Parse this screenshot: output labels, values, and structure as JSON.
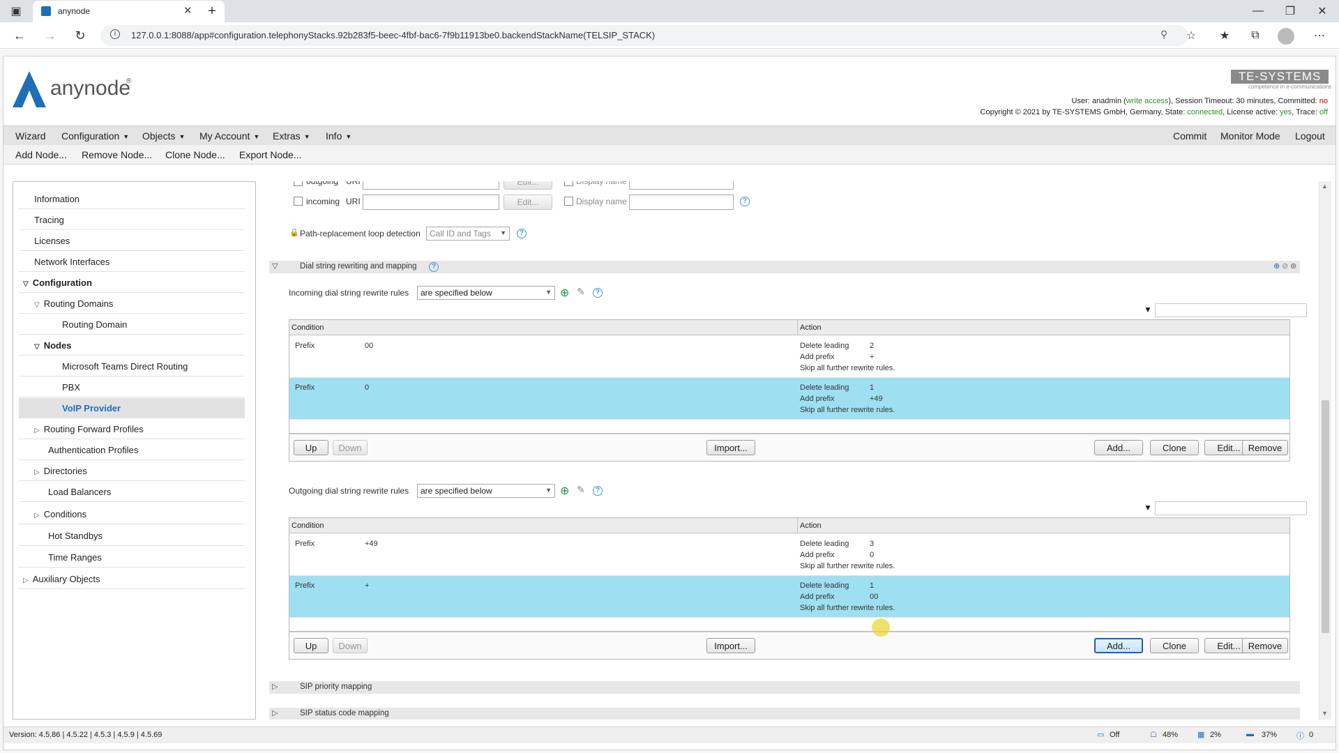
{
  "browser": {
    "tab_title": "anynode",
    "url": "127.0.0.1:8088/app#configuration.telephonyStacks.92b283f5-beec-4fbf-bac6-7f9b11913be0.backendStackName(TELSIP_STACK)"
  },
  "header": {
    "logo_text": "anynode",
    "brand": "TE-SYSTEMS",
    "brand_tagline": "competence in e-communications",
    "user_line_prefix": "User: anadmin (",
    "user_access": "write access",
    "user_line_suffix": "), Session Timeout: 30 minutes, Committed: ",
    "committed": "no",
    "copyright_prefix": "Copyright © 2021 by TE-SYSTEMS GmbH, Germany, State: ",
    "state": "connected",
    "license_prefix": ", License active: ",
    "license_active": "yes",
    "trace_prefix": ", Trace: ",
    "trace": "off"
  },
  "menu": {
    "wizard": "Wizard",
    "configuration": "Configuration",
    "objects": "Objects",
    "my_account": "My Account",
    "extras": "Extras",
    "info": "Info",
    "commit": "Commit",
    "monitor_mode": "Monitor Mode",
    "logout": "Logout"
  },
  "toolbar": {
    "add_node": "Add Node...",
    "remove_node": "Remove Node...",
    "clone_node": "Clone Node...",
    "export_node": "Export Node..."
  },
  "tree": {
    "information": "Information",
    "tracing": "Tracing",
    "licenses": "Licenses",
    "network_interfaces": "Network Interfaces",
    "configuration": "Configuration",
    "routing_domains": "Routing Domains",
    "routing_domain": "Routing Domain",
    "nodes": "Nodes",
    "ms_teams": "Microsoft Teams Direct Routing",
    "pbx": "PBX",
    "voip_provider": "VoIP Provider",
    "routing_forward_profiles": "Routing Forward Profiles",
    "authentication_profiles": "Authentication Profiles",
    "directories": "Directories",
    "load_balancers": "Load Balancers",
    "conditions": "Conditions",
    "hot_standbys": "Hot Standbys",
    "time_ranges": "Time Ranges",
    "auxiliary_objects": "Auxiliary Objects"
  },
  "content": {
    "outgoing_label": "outgoing",
    "incoming_label": "incoming",
    "uri_label": "URI",
    "edit_label": "Edit...",
    "display_name_label": "Display name",
    "path_replacement_label": "Path-replacement loop detection",
    "path_replacement_value": "Call ID and Tags",
    "dial_section_title": "Dial string rewriting and mapping",
    "incoming_rules_label": "Incoming dial string rewrite rules",
    "incoming_rules_value": "are specified below",
    "outgoing_rules_label": "Outgoing dial string rewrite rules",
    "outgoing_rules_value": "are specified below",
    "col_condition": "Condition",
    "col_action": "Action",
    "incoming_rows": [
      {
        "cond": "Prefix",
        "val": "00",
        "a1": "Delete leading",
        "v1": "2",
        "a2": "Add prefix",
        "v2": "+",
        "a3": "Skip all further rewrite rules."
      },
      {
        "cond": "Prefix",
        "val": "0",
        "a1": "Delete leading",
        "v1": "1",
        "a2": "Add prefix",
        "v2": "+49",
        "a3": "Skip all further rewrite rules."
      }
    ],
    "outgoing_rows": [
      {
        "cond": "Prefix",
        "val": "+49",
        "a1": "Delete leading",
        "v1": "3",
        "a2": "Add prefix",
        "v2": "0",
        "a3": "Skip all further rewrite rules."
      },
      {
        "cond": "Prefix",
        "val": "+",
        "a1": "Delete leading",
        "v1": "1",
        "a2": "Add prefix",
        "v2": "00",
        "a3": "Skip all further rewrite rules."
      }
    ],
    "buttons": {
      "up": "Up",
      "down": "Down",
      "import": "Import...",
      "add": "Add...",
      "clone": "Clone",
      "edit": "Edit...",
      "remove": "Remove"
    },
    "sip_priority": "SIP priority mapping",
    "sip_status": "SIP status code mapping"
  },
  "status": {
    "version": "Version: 4.5.86 | 4.5.22 | 4.5.3 | 4.5.9 | 4.5.69",
    "net": "Off",
    "mem": "48%",
    "cpu": "2%",
    "disk": "37%",
    "alerts": "0"
  },
  "colors": {
    "highlight": "#9ee0f2",
    "brand": "#1e6fb8",
    "accent_green": "#2e8b2e",
    "accent_red": "#c00000"
  }
}
